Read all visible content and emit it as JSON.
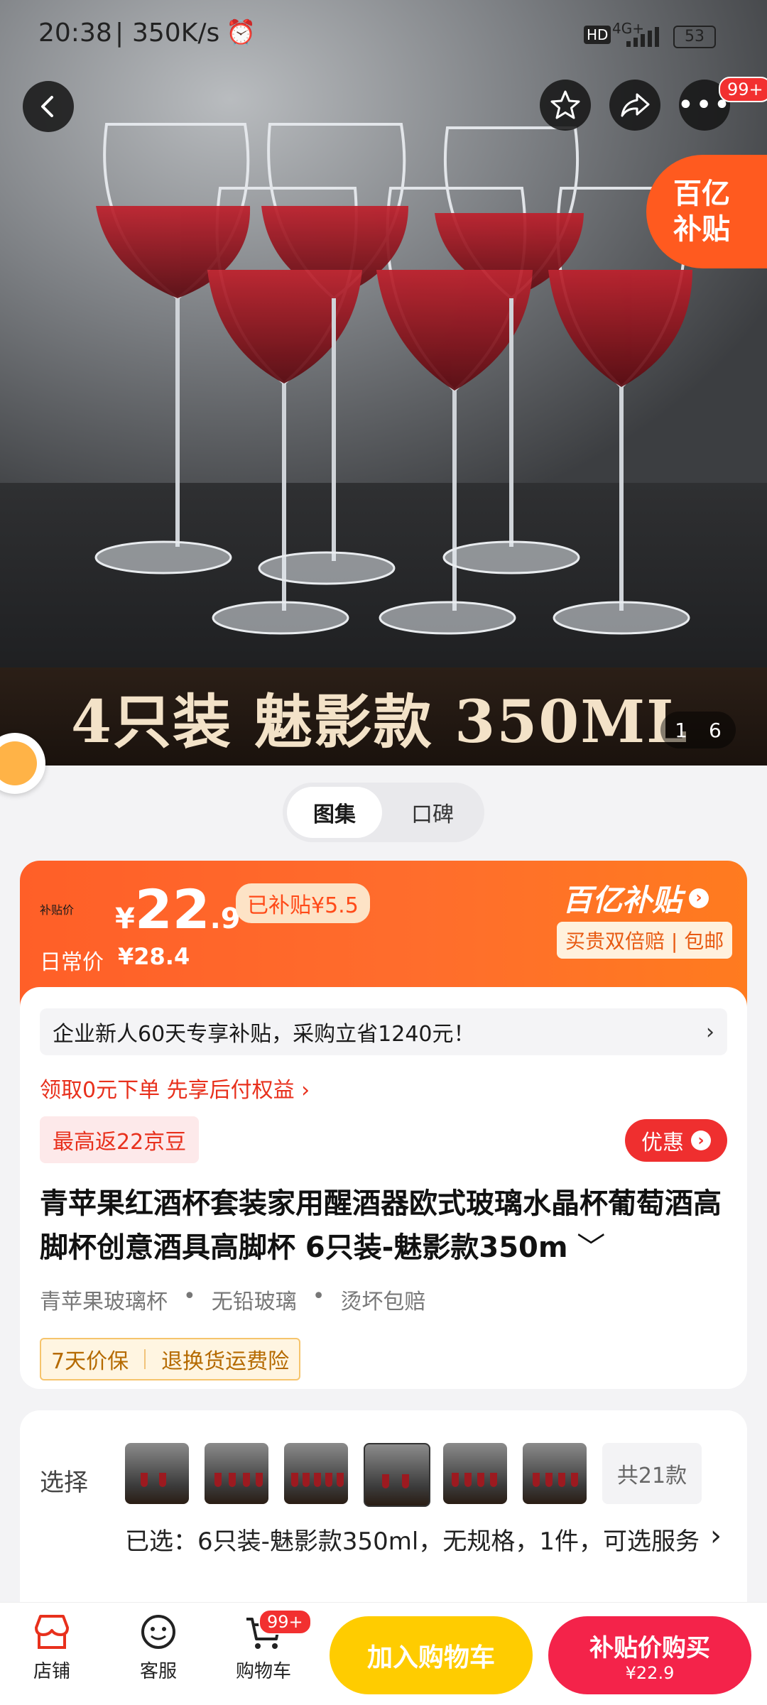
{
  "status_bar": {
    "time": "20:38",
    "speed": "350K/s",
    "network": "4G+",
    "battery": "53"
  },
  "top_actions": {
    "badge": "99+"
  },
  "hero": {
    "banner_text": "4只装 魅影款 350ML",
    "subsidy_tag_line1": "百亿",
    "subsidy_tag_line2": "补贴",
    "pager_current": "1",
    "pager_total": "6"
  },
  "view_toggle": {
    "active": "图集",
    "inactive": "口碑"
  },
  "price": {
    "subsidy_label": "补贴价",
    "currency": "¥",
    "integer": "22",
    "decimal": ".9",
    "subsidized_chip": "已补贴¥5.5",
    "daily_label": "日常价",
    "daily_price": "¥28.4",
    "brand": "百亿补贴",
    "brand_chip": "买贵双倍赔 | 包邮"
  },
  "info": {
    "enterprise_text": "企业新人60天专享补贴，采购立省1240元！",
    "paylater_text": "领取0元下单 先享后付权益 ›",
    "jd_bean": "最高返22京豆",
    "youhui": "优惠"
  },
  "product": {
    "title": "青苹果红酒杯套装家用醒酒器欧式玻璃水晶杯葡萄酒高脚杯创意酒具高脚杯 6只装-魅影款350m",
    "tags": [
      "青苹果玻璃杯",
      "无铅玻璃",
      "烫坏包赔"
    ],
    "guarantees": [
      "7天价保",
      "退换货运费险"
    ]
  },
  "selection": {
    "label": "选择",
    "all_label": "共21款",
    "selected_text": "已选：6只装-魅影款350ml，无规格，1件，可选服务"
  },
  "bottom": {
    "shop": "店铺",
    "service": "客服",
    "cart": "购物车",
    "cart_badge": "99+",
    "add_cart": "加入购物车",
    "buy": "补贴价购买",
    "buy_price": "¥22.9"
  },
  "colors": {
    "accent": "#ff5f28",
    "red": "#f4234a",
    "yellow": "#ffcc00"
  }
}
